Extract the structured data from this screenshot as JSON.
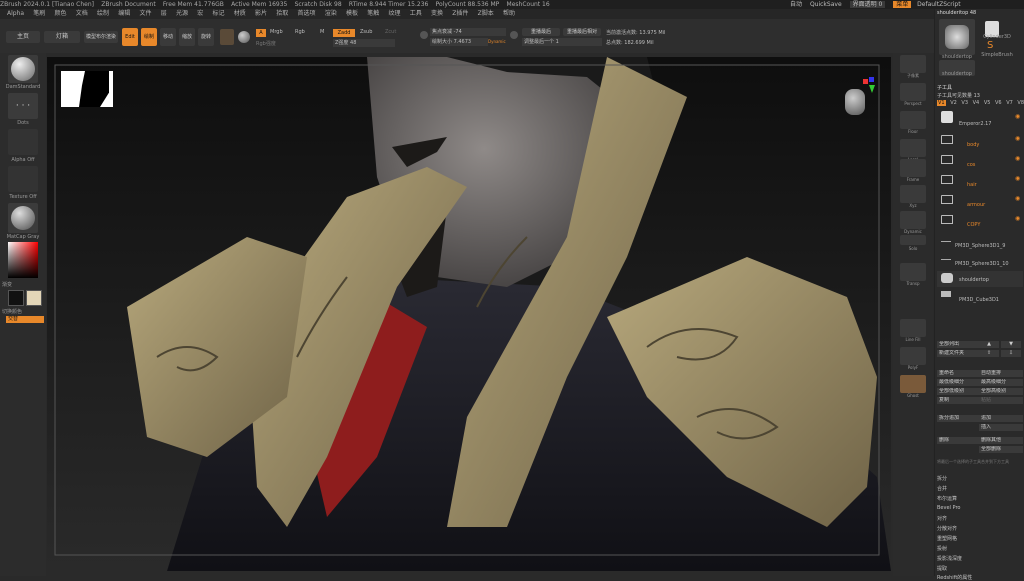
{
  "titlebar": {
    "items": [
      "ZBrush 2024.0.1 [Tianao Chen]",
      "ZBrush Document",
      "Free Mem 41.776GB",
      "Active Mem 16935",
      "Scratch Disk 98",
      "RTime 8.944 Timer 15.236",
      "PolyCount 88.536 MP",
      "MeshCount 16"
    ],
    "right": [
      "自动",
      "QuickSave",
      "界面透明 0",
      "菜单",
      "DefaultZScript"
    ]
  },
  "menubar": [
    "Alpha",
    "笔刷",
    "颜色",
    "文档",
    "绘制",
    "编辑",
    "文件",
    "层",
    "光源",
    "宏",
    "标记",
    "材质",
    "影片",
    "拾取",
    "首选项",
    "渲染",
    "模板",
    "笔触",
    "纹理",
    "工具",
    "变换",
    "Z插件",
    "Z脚本",
    "帮助"
  ],
  "toolbar": {
    "home": "主页",
    "lightbox": "灯箱",
    "liveboolean": "模型布尔渲染",
    "modes": [
      "Edit",
      "绘制",
      "移动",
      "缩放",
      "旋转"
    ],
    "a_btn": "A",
    "mrgb": "Mrgb",
    "rgb": "Rgb",
    "m": "M",
    "zadd": "Zadd",
    "zsub": "Zsub",
    "zcut": "Zcut",
    "rgb_intensity": "Rgb强度",
    "z_intensity": "Z强度 48",
    "focal_shift": "焦点衰减 -74",
    "draw_size": "绘制大小 7.4673",
    "dynamic": "Dynamic",
    "replay_last": "重播最后",
    "replay_last_rel": "重播最后相对",
    "adjust_last": "调整最后一个 1",
    "active_points": "当前激活点数: 13.975 Mil",
    "total_points": "总点数: 182.699 Mil"
  },
  "leftpanel": {
    "brush": "DamStandard",
    "stroke": "Dots",
    "alpha": "Alpha Off",
    "texture": "Texture Off",
    "material": "MatCap Gray",
    "gradient": "渐变",
    "switch_color": "切换颜色",
    "alternate": "交替"
  },
  "shelf": [
    "子像素",
    "Perspect",
    "Floor",
    "Local",
    "Frame",
    "Xyz",
    "Dynamic",
    "Solo",
    "Transp",
    "Line Fill",
    "PolyF",
    "Ghost"
  ],
  "rightpanel": {
    "header": "shoulderitop 48",
    "tools": [
      "shouldertop",
      "Cylinder3D",
      "SimpleBrush",
      "shouldertop"
    ],
    "subtool_title": "子工具",
    "visible_count": "子工具可见数量 13",
    "tabs": [
      "V1",
      "V2",
      "V3",
      "V4",
      "V5",
      "V6",
      "V7",
      "V8"
    ],
    "subtools": [
      {
        "name": "Emperor2.17",
        "folder": false
      },
      {
        "name": "body",
        "folder": true
      },
      {
        "name": "cos",
        "folder": true
      },
      {
        "name": "hair",
        "folder": true
      },
      {
        "name": "armour",
        "folder": true
      },
      {
        "name": "COPY",
        "folder": true
      },
      {
        "name": "PM3D_Sphere3D1_9",
        "folder": false
      },
      {
        "name": "PM3D_Sphere3D1_10",
        "folder": false
      },
      {
        "name": "shouldertop",
        "folder": false
      },
      {
        "name": "PM3D_Cube3D1",
        "folder": false
      }
    ],
    "buttons_a": [
      "全部列出",
      "新建文件夹"
    ],
    "buttons_b": [
      [
        "重命名",
        "自动重排"
      ],
      [
        "最低级细分",
        "最高级细分"
      ],
      [
        "全部低级别",
        "全部高级别"
      ],
      [
        "复制",
        "粘贴"
      ],
      [
        "拆分追加",
        "追加"
      ],
      [
        "",
        "插入"
      ],
      [
        "删除",
        "删除其他"
      ],
      [
        "",
        "全部删除"
      ]
    ],
    "notice": "将最后一个选择的子工具合并到下方工具",
    "menu": [
      "拆分",
      "合并",
      "布尔运算",
      "Bevel Pro",
      "对齐",
      "分散对齐",
      "重塑网格",
      "投射",
      "投影浅深度",
      "提取",
      "Redshift的属性"
    ]
  }
}
